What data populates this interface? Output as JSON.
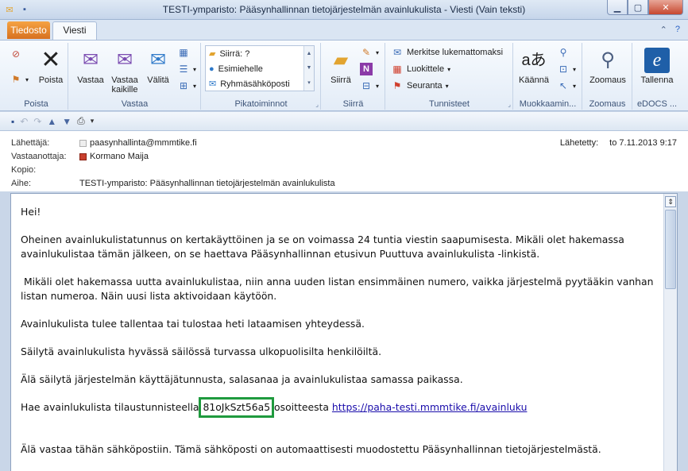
{
  "window": {
    "title": "TESTI-ymparisto:  Pääsynhallinnan tietojärjestelmän avainlukulista  -  Viesti (Vain teksti)"
  },
  "tabs": {
    "file": "Tiedosto",
    "message": "Viesti"
  },
  "ribbon": {
    "poista": {
      "delete_label": "Poista",
      "group_label": "Poista"
    },
    "vastaa": {
      "reply": "Vastaa",
      "reply_all": "Vastaa kaikille",
      "forward": "Välitä",
      "group_label": "Vastaa"
    },
    "pikatoiminnot": {
      "items": [
        "Siirrä: ?",
        "Esimiehelle",
        "Ryhmäsähköposti"
      ],
      "group_label": "Pikatoiminnot"
    },
    "siirra": {
      "move": "Siirrä",
      "group_label": "Siirrä"
    },
    "tunnisteet": {
      "mark_unread": "Merkitse lukemattomaksi",
      "categorize": "Luokittele",
      "follow_up": "Seuranta",
      "group_label": "Tunnisteet"
    },
    "muokkaaminen": {
      "translate": "Käännä",
      "group_label": "Muokkaamin..."
    },
    "zoomaus": {
      "zoom": "Zoomaus",
      "group_label": "Zoomaus"
    },
    "edocs": {
      "save": "Tallenna",
      "group_label": "eDOCS ..."
    }
  },
  "header": {
    "from_label": "Lähettäjä:",
    "from_value": "paasynhallinta@mmmtike.fi",
    "to_label": "Vastaanottaja:",
    "to_value": "Kormano Maija",
    "cc_label": "Kopio:",
    "subject_label": "Aihe:",
    "subject_value": "TESTI-ymparisto:  Pääsynhallinnan tietojärjestelmän avainlukulista",
    "sent_label": "Lähetetty:",
    "sent_value": "to 7.11.2013 9:17"
  },
  "body": {
    "greeting": "Hei!",
    "p1": "Oheinen avainlukulistatunnus on kertakäyttöinen ja se on voimassa 24 tuntia viestin saapumisesta. Mikäli olet hakemassa avainlukulistaa tämän jälkeen, on se haettava Pääsynhallinnan etusivun Puuttuva avainlukulista -linkistä.",
    "p2": " Mikäli olet hakemassa uutta avainlukulistaa, niin anna uuden listan ensimmäinen numero, vaikka järjestelmä pyytääkin vanhan listan numeroa. Näin uusi lista aktivoidaan käytöön.",
    "p3": "Avainlukulista tulee tallentaa tai tulostaa heti lataamisen yhteydessä.",
    "p4": "Säilytä avainlukulista hyvässä säilössä turvassa ulkopuolisilta henkilöiltä.",
    "p5": "Älä säilytä järjestelmän käyttäjätunnusta, salasanaa ja avainlukulistaa samassa paikassa.",
    "p6_before": "Hae avainlukulista tilaustunnisteella ",
    "order_code": "81oJkSzt56a5",
    "p6_middle": " osoitteesta ",
    "link": "https://paha-testi.mmmtike.fi/avainluku",
    "p7": "Älä vastaa tähän sähköpostiin. Tämä sähköposti on automaattisesti muodostettu Pääsynhallinnan tietojärjestelmästä."
  }
}
